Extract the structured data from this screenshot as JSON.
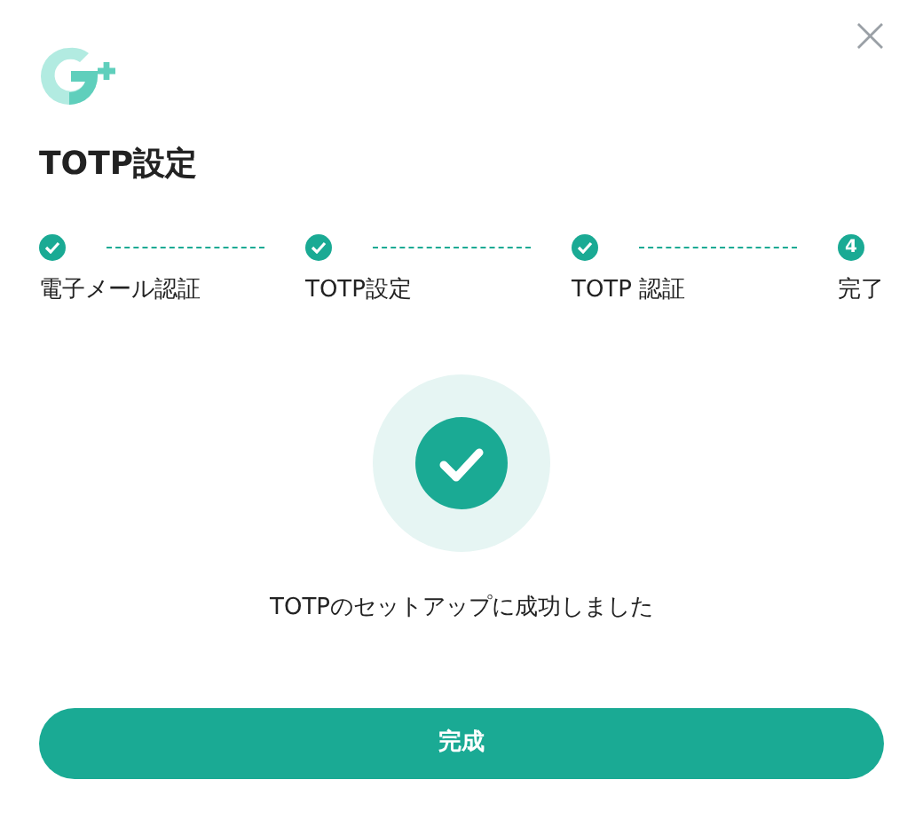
{
  "close": "×",
  "title": "TOTP設定",
  "steps": [
    {
      "label": "電子メール認証",
      "done": true
    },
    {
      "label": "TOTP設定",
      "done": true
    },
    {
      "label": "TOTP 認証",
      "done": true
    },
    {
      "label": "完了",
      "done": false,
      "number": "4"
    }
  ],
  "message": "TOTPのセットアップに成功しました",
  "button": "完成"
}
